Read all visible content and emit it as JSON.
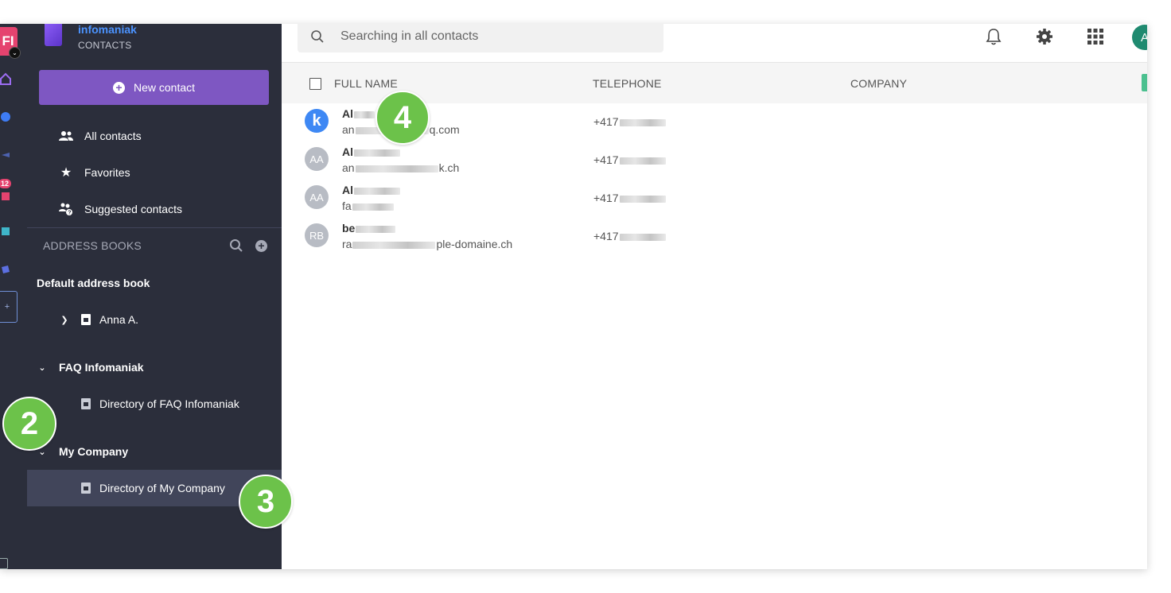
{
  "brand": {
    "name": "infomaniak",
    "subtitle": "CONTACTS"
  },
  "rail": {
    "avatar_initials": "FI",
    "badge_count": "12",
    "add_label": "+"
  },
  "sidebar": {
    "new_contact_label": "New contact",
    "nav": [
      {
        "label": "All contacts",
        "icon": "people-icon"
      },
      {
        "label": "Favorites",
        "icon": "star-icon"
      },
      {
        "label": "Suggested contacts",
        "icon": "suggested-people-icon"
      }
    ],
    "address_books_label": "ADDRESS BOOKS",
    "default_book_label": "Default address book",
    "tree": {
      "anna": "Anna A.",
      "faq_group": "FAQ Infomaniak",
      "faq_directory": "Directory of FAQ Infomaniak",
      "company_group": "My Company",
      "company_directory": "Directory of My Company"
    }
  },
  "search": {
    "placeholder": "Searching in all contacts"
  },
  "header": {
    "user_initial": "A"
  },
  "table": {
    "columns": {
      "full_name": "FULL NAME",
      "telephone": "TELEPHONE",
      "company": "COMPANY"
    },
    "rows": [
      {
        "avatar": "k",
        "name_prefix": "Al",
        "email_prefix": "an",
        "email_suffix": "q.com",
        "phone_prefix": "+417"
      },
      {
        "avatar": "AA",
        "name_prefix": "Al",
        "email_prefix": "an",
        "email_suffix": "k.ch",
        "phone_prefix": "+417"
      },
      {
        "avatar": "AA",
        "name_prefix": "Al",
        "email_prefix": "fa",
        "email_suffix": "",
        "phone_prefix": "+417"
      },
      {
        "avatar": "RB",
        "name_prefix": "be",
        "email_prefix": "ra",
        "email_suffix": "ple-domaine.ch",
        "phone_prefix": "+417"
      }
    ]
  },
  "markers": {
    "m2": "2",
    "m3": "3",
    "m4": "4"
  },
  "colors": {
    "accent": "#7e57c2",
    "sidebar": "#2b2e3b",
    "marker": "#6cc24a",
    "brand": "#4b93ff"
  }
}
